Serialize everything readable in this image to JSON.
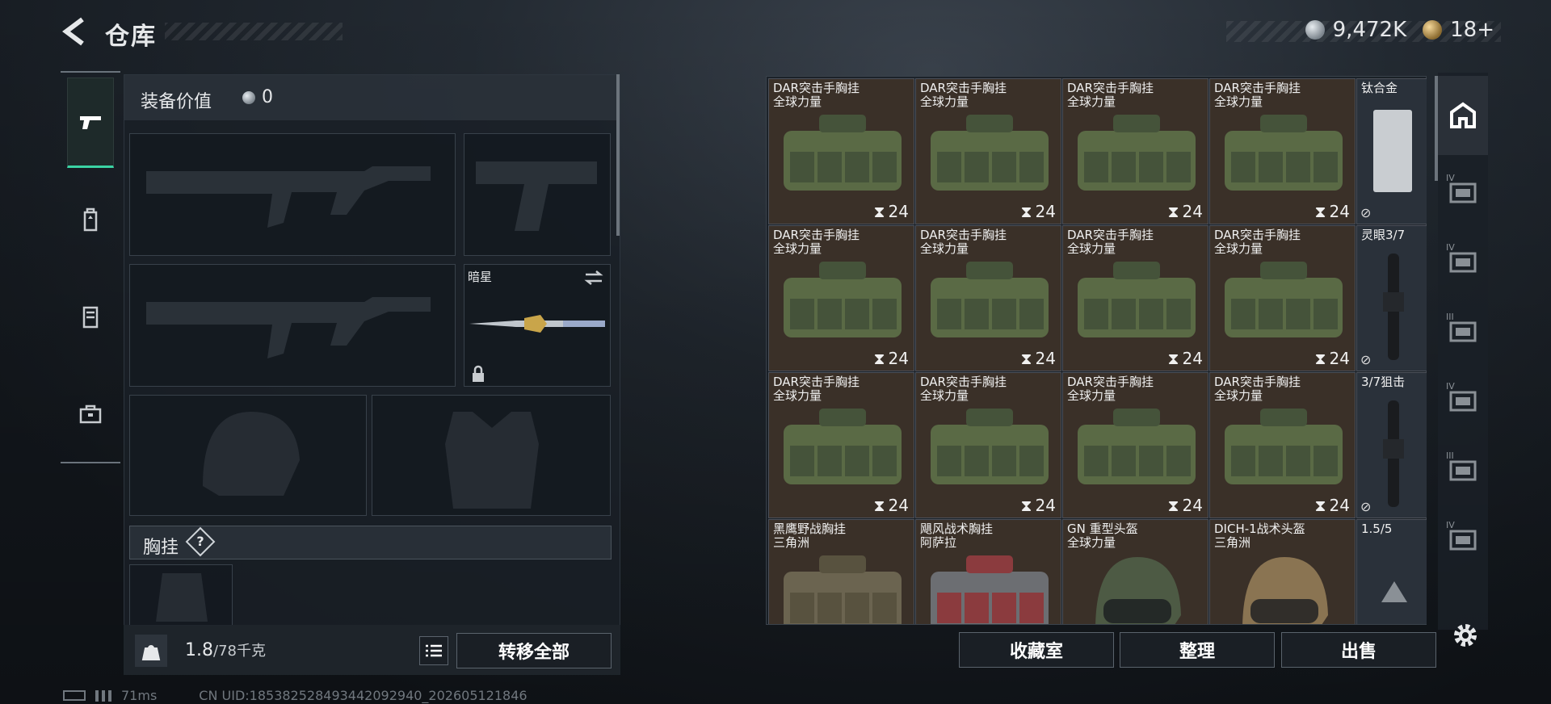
{
  "header": {
    "title": "仓库",
    "silver": "9,472K",
    "gold": "18+"
  },
  "loadout": {
    "value_label": "装备价值",
    "value": "0",
    "knife_name": "暗星",
    "chest_label": "胸挂",
    "chest_help": "?"
  },
  "bottom": {
    "weight": "1.8",
    "weight_cap": "/78千克",
    "transfer_all": "转移全部"
  },
  "storage": {
    "items": [
      {
        "l1": "DAR突击手胸挂",
        "l2": "全球力量",
        "qty": "24"
      },
      {
        "l1": "DAR突击手胸挂",
        "l2": "全球力量",
        "qty": "24"
      },
      {
        "l1": "DAR突击手胸挂",
        "l2": "全球力量",
        "qty": "24"
      },
      {
        "l1": "DAR突击手胸挂",
        "l2": "全球力量",
        "qty": "24"
      },
      {
        "l1": "DAR突击手胸挂",
        "l2": "全球力量",
        "qty": "24"
      },
      {
        "l1": "DAR突击手胸挂",
        "l2": "全球力量",
        "qty": "24"
      },
      {
        "l1": "DAR突击手胸挂",
        "l2": "全球力量",
        "qty": "24"
      },
      {
        "l1": "DAR突击手胸挂",
        "l2": "全球力量",
        "qty": "24"
      },
      {
        "l1": "DAR突击手胸挂",
        "l2": "全球力量",
        "qty": "24"
      },
      {
        "l1": "DAR突击手胸挂",
        "l2": "全球力量",
        "qty": "24"
      },
      {
        "l1": "DAR突击手胸挂",
        "l2": "全球力量",
        "qty": "24"
      },
      {
        "l1": "DAR突击手胸挂",
        "l2": "全球力量",
        "qty": "24"
      },
      {
        "l1": "黑鹰野战胸挂",
        "l2": "三角洲",
        "qty": ""
      },
      {
        "l1": "飓风战术胸挂",
        "l2": "阿萨拉",
        "qty": ""
      },
      {
        "l1": "GN 重型头盔",
        "l2": "全球力量",
        "qty": ""
      },
      {
        "l1": "DICH-1战术头盔",
        "l2": "三角洲",
        "qty": ""
      }
    ],
    "side_items": [
      {
        "label": "钛合金"
      },
      {
        "label": "灵眼3/7"
      },
      {
        "label": "3/7狙击"
      },
      {
        "label": "1.5/5"
      }
    ],
    "buttons": {
      "collection": "收藏室",
      "sort": "整理",
      "sell": "出售"
    }
  },
  "sidecats": [
    "IV",
    "IV",
    "III",
    "IV",
    "III",
    "IV"
  ],
  "status": {
    "ping": "71ms",
    "uid": "CN UID:185382528493442092940_202605121846"
  },
  "colors": {
    "accent": "#3bd3a4",
    "cell_brown": "#3a3028"
  }
}
